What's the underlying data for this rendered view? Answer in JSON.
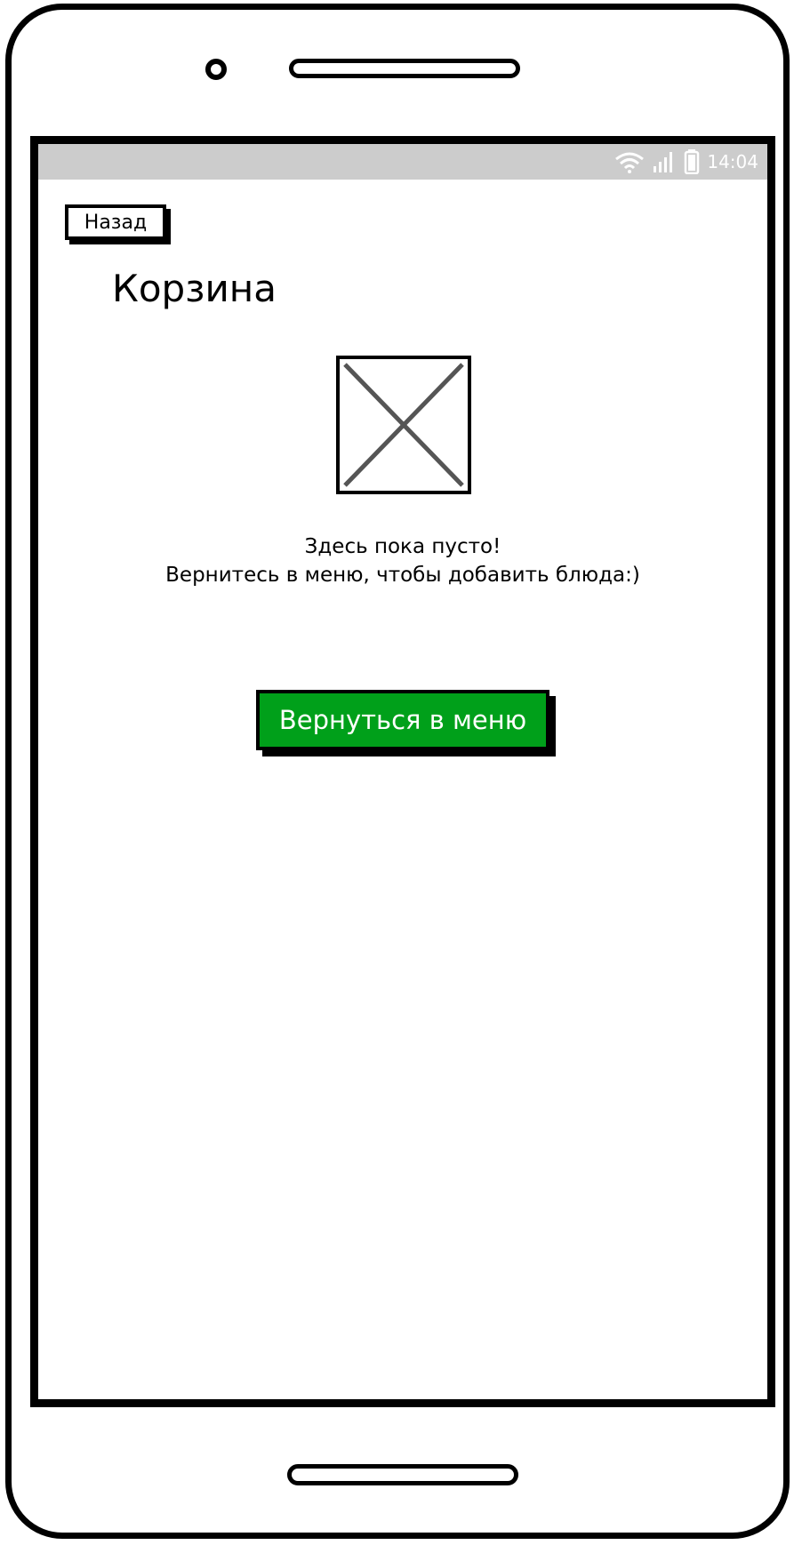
{
  "status_bar": {
    "time": "14:04",
    "wifi_icon": "wifi-icon",
    "signal_icon": "signal-icon",
    "battery_icon": "battery-icon"
  },
  "header": {
    "back_label": "Назад",
    "title": "Корзина"
  },
  "empty_state": {
    "image_icon": "image-placeholder-icon",
    "line1": "Здесь пока пусто!",
    "line2": "Вернитесь в меню, чтобы добавить блюда:)"
  },
  "actions": {
    "return_label": "Вернуться в меню"
  },
  "colors": {
    "accent": "#00a01a",
    "status_bar": "#cccccc"
  }
}
